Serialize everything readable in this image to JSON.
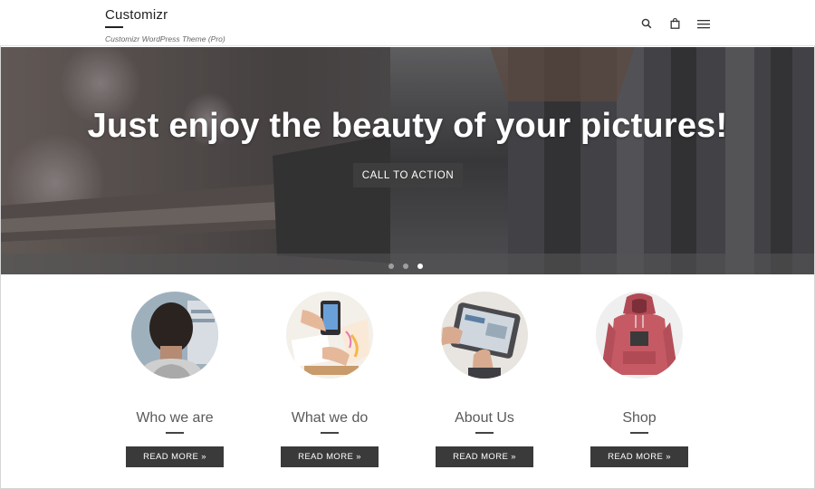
{
  "header": {
    "site_title": "Customizr",
    "tagline": "Customizr WordPress Theme (Pro)",
    "icons": [
      "search-icon",
      "shopping-bag-icon",
      "hamburger-menu-icon"
    ]
  },
  "hero": {
    "heading": "Just enjoy the beauty of your pictures!",
    "cta_label": "CALL TO ACTION",
    "slides": 3,
    "active_slide": 3
  },
  "features": [
    {
      "title": "Who we are",
      "button": "READ MORE »",
      "image": "man-at-computer-photo"
    },
    {
      "title": "What we do",
      "button": "READ MORE »",
      "image": "hands-with-phone-and-sketches-photo"
    },
    {
      "title": "About Us",
      "button": "READ MORE »",
      "image": "hands-on-tablet-photo"
    },
    {
      "title": "Shop",
      "button": "READ MORE »",
      "image": "pink-hoodie-photo"
    }
  ],
  "colors": {
    "button_bg": "#3a3a3a",
    "hero_text": "#ffffff",
    "title_text": "#5a5a5a"
  }
}
